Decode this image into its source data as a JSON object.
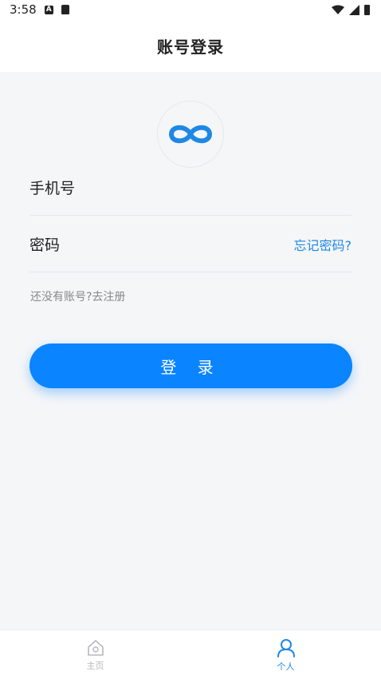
{
  "status_bar": {
    "time": "3:58"
  },
  "header": {
    "title": "账号登录"
  },
  "form": {
    "phone_label": "手机号",
    "password_label": "密码",
    "forgot_link": "忘记密码?",
    "register_link": "还没有账号?去注册",
    "login_button": "登 录"
  },
  "tabbar": {
    "items": [
      {
        "label": "主页",
        "icon": "home-icon",
        "active": false
      },
      {
        "label": "个人",
        "icon": "person-icon",
        "active": true
      }
    ]
  },
  "colors": {
    "accent": "#0a84ff",
    "link": "#1e88e5",
    "background": "#f5f6f8"
  }
}
